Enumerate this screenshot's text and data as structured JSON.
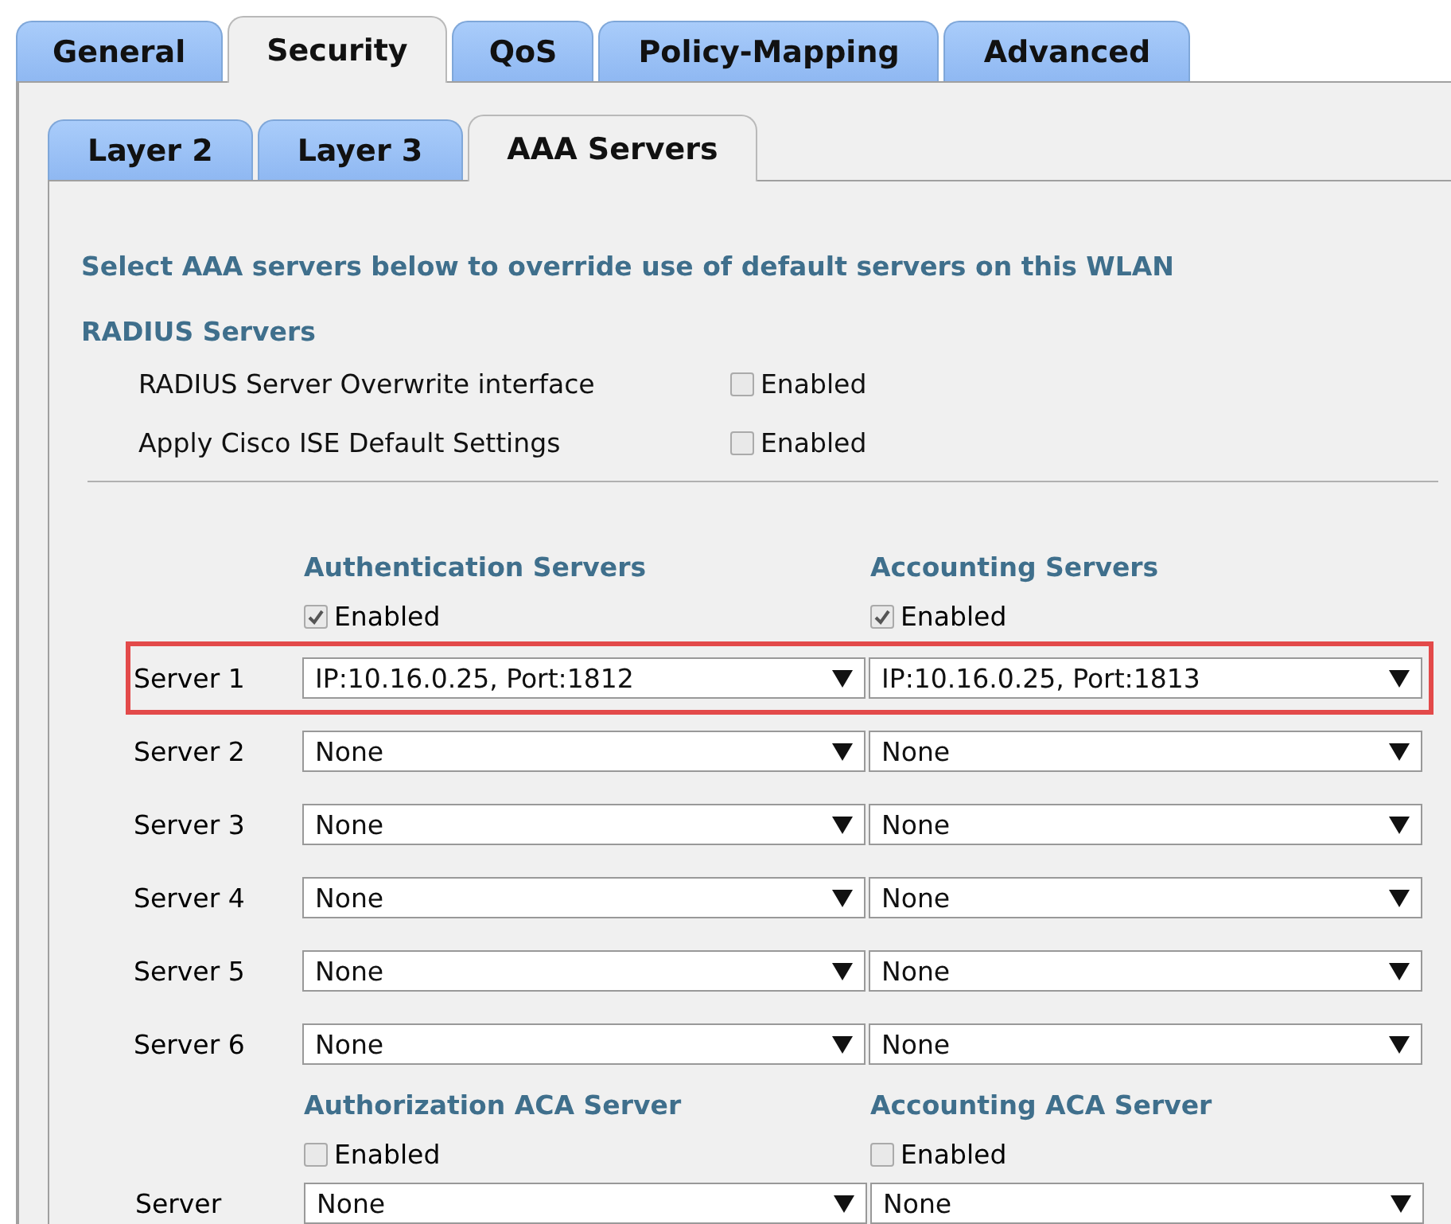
{
  "tabs": [
    {
      "label": "General",
      "selected": false
    },
    {
      "label": "Security",
      "selected": true
    },
    {
      "label": "QoS",
      "selected": false
    },
    {
      "label": "Policy-Mapping",
      "selected": false
    },
    {
      "label": "Advanced",
      "selected": false
    }
  ],
  "subtabs": [
    {
      "label": "Layer 2",
      "selected": false
    },
    {
      "label": "Layer 3",
      "selected": false
    },
    {
      "label": "AAA Servers",
      "selected": true
    }
  ],
  "intro": "Select AAA servers below to override use of default servers on this WLAN",
  "radius": {
    "heading": "RADIUS Servers",
    "options": [
      {
        "label": "RADIUS Server Overwrite interface",
        "checked": false,
        "checkbox_label": "Enabled"
      },
      {
        "label": "Apply Cisco ISE Default Settings",
        "checked": false,
        "checkbox_label": "Enabled"
      }
    ]
  },
  "servers": {
    "columns": [
      {
        "heading": "Authentication Servers",
        "checked": true,
        "checkbox_label": "Enabled"
      },
      {
        "heading": "Accounting Servers",
        "checked": true,
        "checkbox_label": "Enabled"
      }
    ],
    "rows": [
      {
        "label": "Server 1",
        "highlighted": true,
        "values": [
          "IP:10.16.0.25, Port:1812",
          "IP:10.16.0.25, Port:1813"
        ]
      },
      {
        "label": "Server 2",
        "highlighted": false,
        "values": [
          "None",
          "None"
        ]
      },
      {
        "label": "Server 3",
        "highlighted": false,
        "values": [
          "None",
          "None"
        ]
      },
      {
        "label": "Server 4",
        "highlighted": false,
        "values": [
          "None",
          "None"
        ]
      },
      {
        "label": "Server 5",
        "highlighted": false,
        "values": [
          "None",
          "None"
        ]
      },
      {
        "label": "Server 6",
        "highlighted": false,
        "values": [
          "None",
          "None"
        ]
      }
    ]
  },
  "aca": {
    "columns": [
      {
        "heading": "Authorization ACA Server",
        "checked": false,
        "checkbox_label": "Enabled"
      },
      {
        "heading": "Accounting ACA Server",
        "checked": false,
        "checkbox_label": "Enabled"
      }
    ],
    "row": {
      "label": "Server",
      "values": [
        "None",
        "None"
      ]
    }
  }
}
